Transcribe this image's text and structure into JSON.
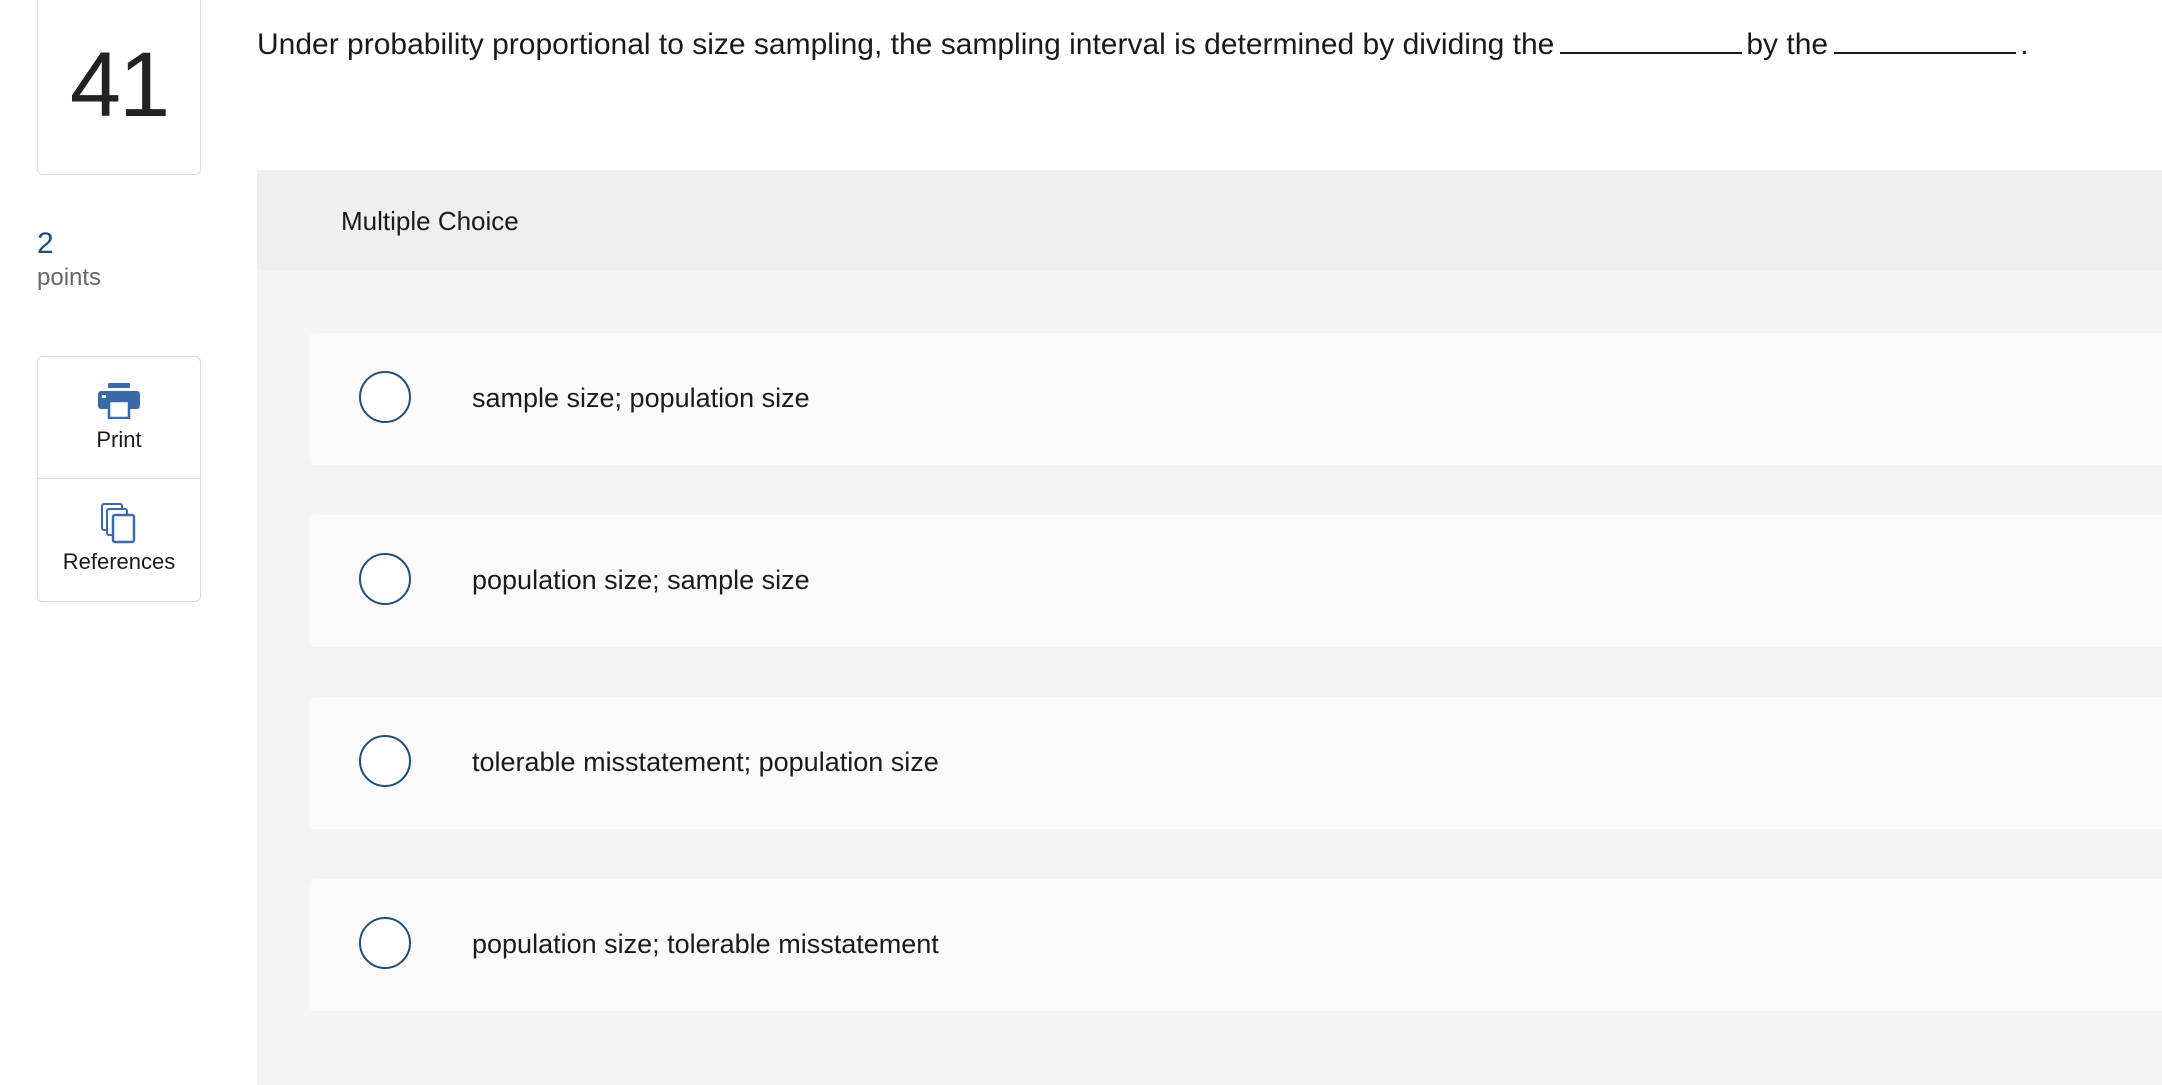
{
  "question_number": "41",
  "points": {
    "value": "2",
    "label": "points"
  },
  "tools": {
    "print_label": "Print",
    "references_label": "References",
    "print_icon": "printer-icon",
    "references_icon": "documents-icon"
  },
  "question": {
    "prefix": "Under probability proportional to size sampling, the sampling interval is determined by dividing the",
    "middle": "by the",
    "suffix": "."
  },
  "answer_panel": {
    "title": "Multiple Choice",
    "options": [
      {
        "label": "sample size; population size"
      },
      {
        "label": "population size; sample size"
      },
      {
        "label": "tolerable misstatement; population size"
      },
      {
        "label": "population size; tolerable misstatement"
      }
    ]
  },
  "colors": {
    "accent": "#1f4e79",
    "icon_blue": "#3a6aa8",
    "panel_bg": "#f4f4f4",
    "option_bg": "#fafafa"
  }
}
